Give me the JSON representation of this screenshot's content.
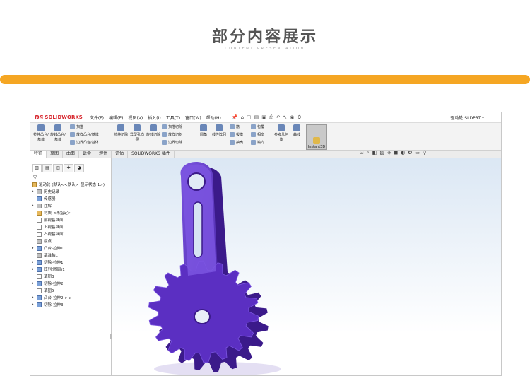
{
  "header": {
    "title": "部分内容展示",
    "subtitle": "CONTENT PRESENTATION",
    "accent_color": "#f5a623"
  },
  "app": {
    "logo_ds": "DS",
    "logo_text": "SOLIDWORKS",
    "brand_color": "#d7282f",
    "menu": [
      "文件(F)",
      "编辑(E)",
      "视图(V)",
      "插入(I)",
      "工具(T)",
      "窗口(W)",
      "帮助(H)"
    ],
    "document_name": "驱动轮.SLDPRT *"
  },
  "ribbon": {
    "extrude_boss": "拉伸凸台/基体",
    "revolve_boss": "旋转凸台/基体",
    "sweep": "扫描",
    "loft_boss": "放样凸台/基体",
    "boundary_boss": "边界凸台/基体",
    "extrude_cut": "拉伸切除",
    "hole_wizard": "异型孔向导",
    "revolve_cut": "旋转切除",
    "swept_cut": "扫描切除",
    "lofted_cut": "放样切割",
    "boundary_cut": "边界切除",
    "fillet": "圆角",
    "linear_pattern": "线性阵列",
    "rib": "筋",
    "draft": "拔模",
    "shell": "抽壳",
    "wrap": "包覆",
    "intersect": "相交",
    "mirror": "镜向",
    "ref_geometry": "参考几何体",
    "curves": "曲线",
    "instant3d": "Instant3D"
  },
  "tabs": [
    "特征",
    "草图",
    "曲面",
    "钣金",
    "焊件",
    "评估",
    "SOLIDWORKS 插件"
  ],
  "tree": {
    "root": "驱动轮 (默认<<默认>_显示状态 1>)",
    "items": [
      {
        "label": "历史记录",
        "expand": "▸"
      },
      {
        "label": "传感器",
        "expand": ""
      },
      {
        "label": "注解",
        "expand": "▸"
      },
      {
        "label": "材质 <未指定>",
        "expand": ""
      },
      {
        "label": "前视基准面",
        "expand": ""
      },
      {
        "label": "上视基准面",
        "expand": ""
      },
      {
        "label": "右视基准面",
        "expand": ""
      },
      {
        "label": "原点",
        "expand": ""
      },
      {
        "label": "凸台-拉伸1",
        "expand": "▸"
      },
      {
        "label": "基准轴1",
        "expand": ""
      },
      {
        "label": "切除-拉伸1",
        "expand": "▸"
      },
      {
        "label": "阵列(圆周)1",
        "expand": "▸"
      },
      {
        "label": "草图3",
        "expand": ""
      },
      {
        "label": "切除-拉伸2",
        "expand": "▸"
      },
      {
        "label": "草图5",
        "expand": ""
      },
      {
        "label": "凸台-拉伸2-> x",
        "expand": "▸"
      },
      {
        "label": "切除-拉伸3",
        "expand": "▸"
      }
    ]
  },
  "model": {
    "part_color": "#5b2fc2",
    "part_dark": "#3b1a8a",
    "part_light": "#7b55e0"
  }
}
